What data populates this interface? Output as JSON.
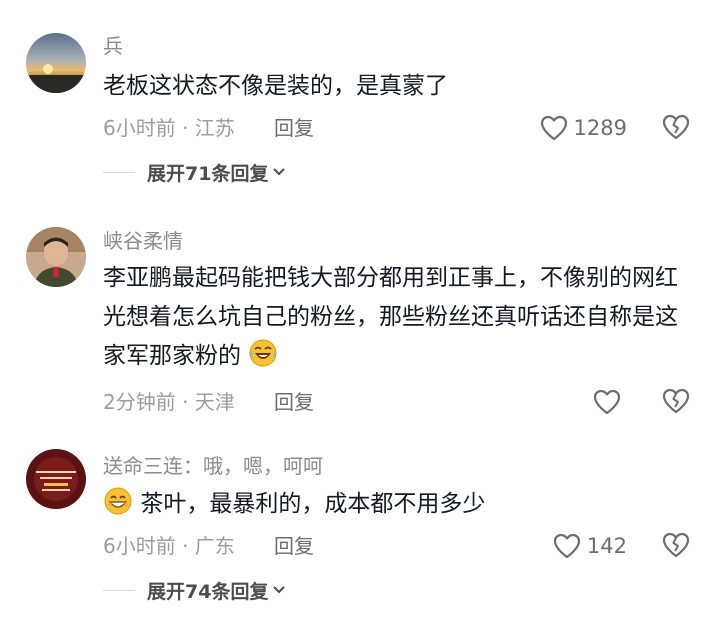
{
  "comments": [
    {
      "username": "兵",
      "text": "老板这状态不像是装的，是真蒙了",
      "time_location": "6小时前 · 江苏",
      "reply_label": "回复",
      "like_count": "1289",
      "expand_label": "展开71条回复"
    },
    {
      "username": "峡谷柔情",
      "text": "李亚鹏最起码能把钱大部分都用到正事上，不像别的网红光想着怎么坑自己的粉丝，那些粉丝还真听话还自称是这家军那家粉的",
      "time_location": "2分钟前 · 天津",
      "reply_label": "回复",
      "like_count": ""
    },
    {
      "username": "送命三连：哦，嗯，呵呵",
      "text": "茶叶，最暴利的，成本都不用多少",
      "time_location": "6小时前 · 广东",
      "reply_label": "回复",
      "like_count": "142",
      "expand_label": "展开74条回复"
    }
  ],
  "icons": {
    "like": "heart-outline-icon",
    "dislike": "broken-heart-icon",
    "expand": "chevron-down-icon",
    "emoji_laugh_cry": "laugh-cry-emoji-icon",
    "emoji_grin": "grin-emoji-icon"
  },
  "colors": {
    "text": "#161823",
    "secondary": "#8a8b91",
    "icon": "#6b6d73"
  }
}
